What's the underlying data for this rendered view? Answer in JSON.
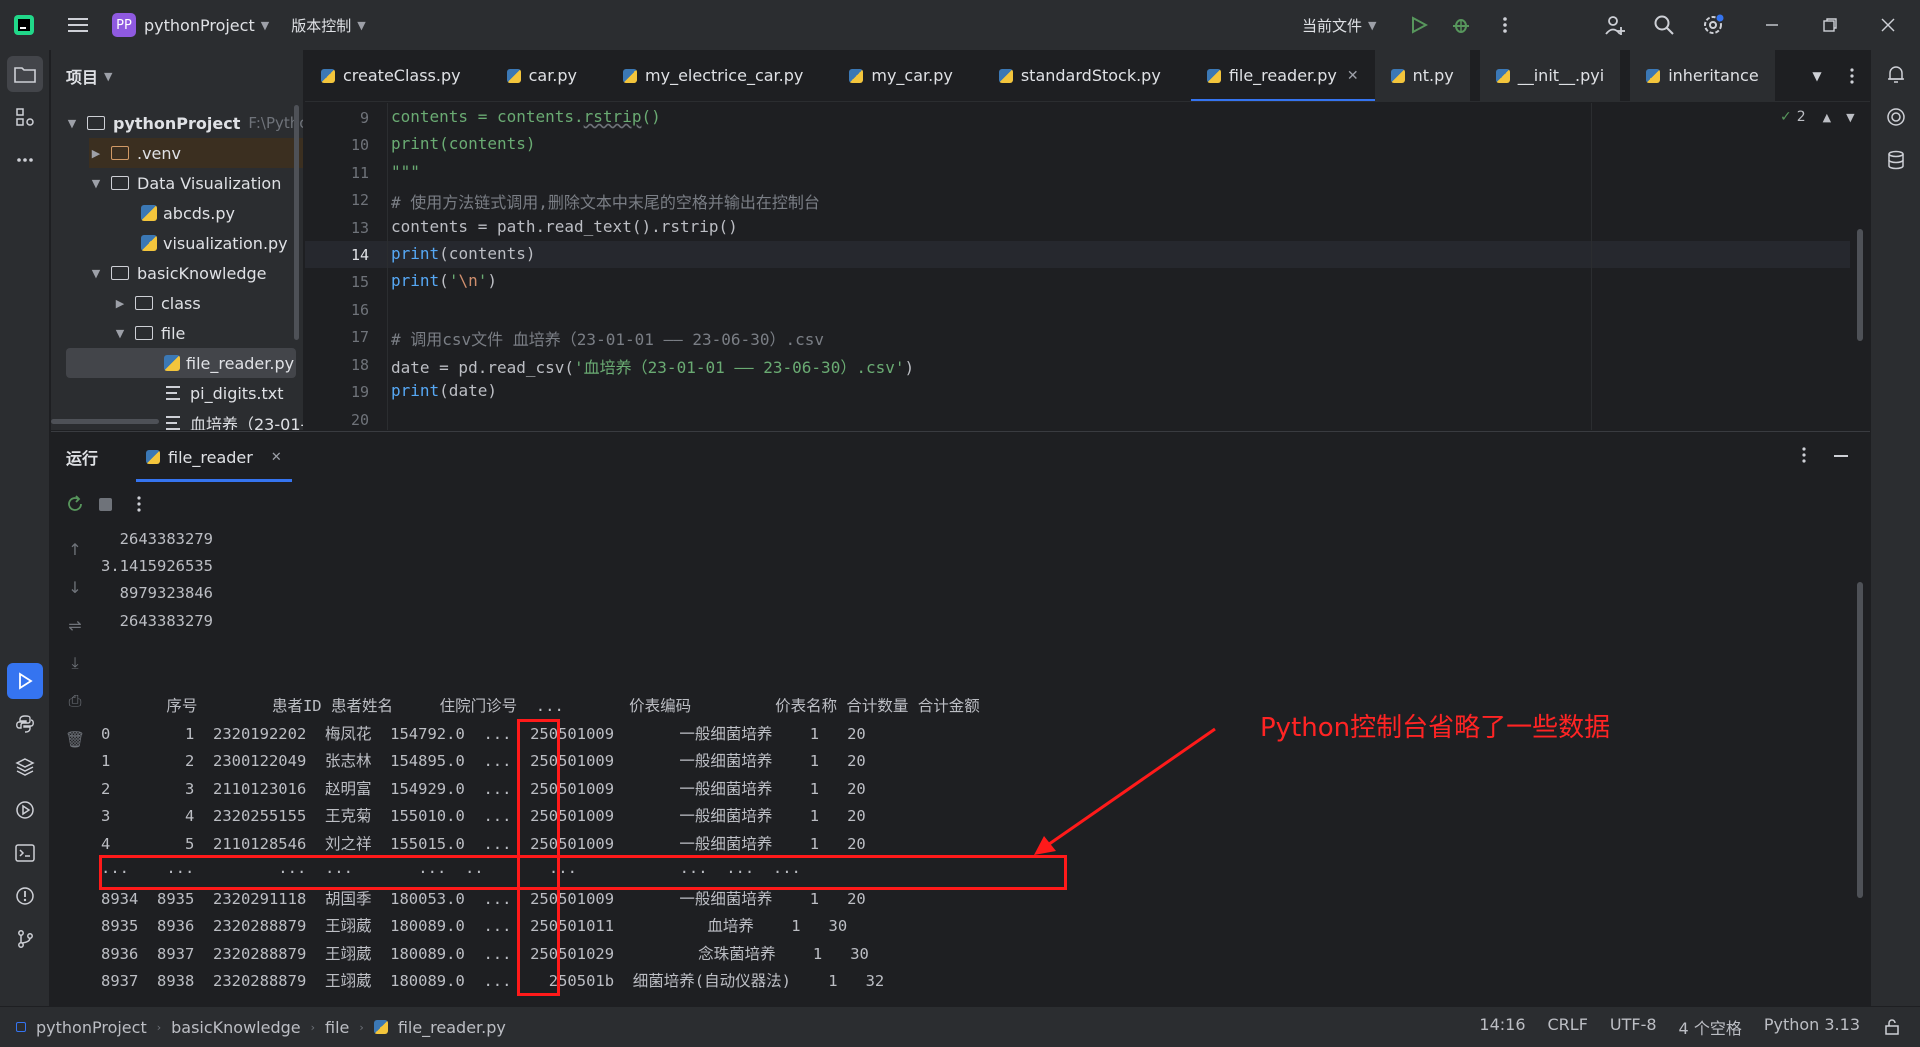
{
  "titlebar": {
    "project_badge": "PP",
    "project_name": "pythonProject",
    "vcs": "版本控制",
    "run_config": "当前文件"
  },
  "project_panel": {
    "title": "项目",
    "root_name": "pythonProject",
    "root_path": "F:\\Pytho",
    "items": [
      {
        "label": ".venv"
      },
      {
        "label": "Data Visualization"
      },
      {
        "label": "abcds.py"
      },
      {
        "label": "visualization.py"
      },
      {
        "label": "basicKnowledge"
      },
      {
        "label": "class"
      },
      {
        "label": "file"
      },
      {
        "label": "file_reader.py"
      },
      {
        "label": "pi_digits.txt"
      },
      {
        "label": "血培养（23-01-("
      }
    ]
  },
  "tabs": [
    {
      "label": "createClass.py"
    },
    {
      "label": "car.py"
    },
    {
      "label": "my_electrice_car.py"
    },
    {
      "label": "my_car.py"
    },
    {
      "label": "standardStock.py"
    },
    {
      "label": "file_reader.py"
    },
    {
      "label": "nt.py"
    },
    {
      "label": "__init__.pyi"
    },
    {
      "label": "inheritance"
    }
  ],
  "editor": {
    "inspection_count": "2",
    "lines": [
      {
        "n": "9"
      },
      {
        "n": "10"
      },
      {
        "n": "11"
      },
      {
        "n": "12"
      },
      {
        "n": "13"
      },
      {
        "n": "14"
      },
      {
        "n": "15"
      },
      {
        "n": "16"
      },
      {
        "n": "17"
      },
      {
        "n": "18"
      },
      {
        "n": "19"
      },
      {
        "n": "20"
      }
    ],
    "code": {
      "l9a": "contents = contents.",
      "l9b": "rstrip",
      "l9c": "()",
      "l10a": "print",
      "l10b": "(contents)",
      "l11": "\"\"\"",
      "l12": "# 使用方法链式调用,删除文本中末尾的空格并输出在控制台",
      "l13": "contents = path.read_text().rstrip()",
      "l14a": "print",
      "l14b": "(contents)",
      "l15a": "print",
      "l15b": "(",
      "l15c": "'",
      "l15d": "\\n",
      "l15e": "'",
      "l15f": ")",
      "l17": "# 调用csv文件 血培养（23-01-01 —— 23-06-30）.csv",
      "l18a": "date = pd.read_csv(",
      "l18b": "'血培养（23-01-01 —— 23-06-30）.csv'",
      "l18c": ")",
      "l19a": "print",
      "l19b": "(date)"
    }
  },
  "run_panel": {
    "title": "运行",
    "tab_label": "file_reader",
    "console": {
      "l1": "  2643383279",
      "l2": "3.1415926535",
      "l3": "  8979323846",
      "l4": "  2643383279",
      "header": "       序号        患者ID 患者姓名     住院门诊号  ...       价表编码         价表名称 合计数量 合计金额",
      "rows": [
        "0        1  2320192202  梅凤花  154792.0  ...  250501009       一般细菌培养    1   20",
        "1        2  2300122049  张志林  154895.0  ...  250501009       一般细菌培养    1   20",
        "2        3  2110123016  赵明富  154929.0  ...  250501009       一般细菌培养    1   20",
        "3        4  2320255155  王克菊  155010.0  ...  250501009       一般细菌培养    1   20",
        "4        5  2110128546  刘之祥  155015.0  ...  250501009       一般细菌培养    1   20",
        "...    ...         ...  ...       ...  ..       ...           ...  ...  ...",
        "8934  8935  2320291118  胡国季  180053.0  ...  250501009       一般细菌培养    1   20",
        "8935  8936  2320288879  王翊葳  180089.0  ...  250501011          血培养    1   30",
        "8936  8937  2320288879  王翊葳  180089.0  ...  250501029         念珠菌培养    1   30",
        "8937  8938  2320288879  王翊葳  180089.0  ...    250501b  细菌培养(自动仪器法)    1   32"
      ]
    }
  },
  "annotation": "Python控制台省略了一些数据",
  "statusbar": {
    "breadcrumb": [
      "pythonProject",
      "basicKnowledge",
      "file",
      "file_reader.py"
    ],
    "position": "14:16",
    "line_sep": "CRLF",
    "encoding": "UTF-8",
    "indent": "4 个空格",
    "interpreter": "Python 3.13"
  }
}
